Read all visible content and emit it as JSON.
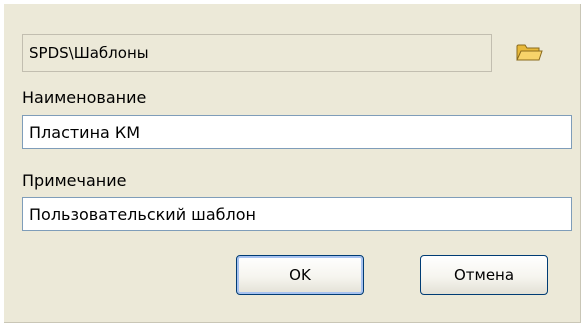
{
  "dialog": {
    "path": "SPDS\\Шаблоны",
    "name_label": "Наименование",
    "name_value": "Пластина КМ",
    "note_label": "Примечание",
    "note_value": "Пользовательский шаблон",
    "ok_label": "OK",
    "cancel_label": "Отмена",
    "browse_icon": "folder-open-icon"
  },
  "colors": {
    "dialog_background": "#ece9d8",
    "input_border": "#7f9db9",
    "button_border": "#003c74",
    "folder_icon": "#f7d36a"
  }
}
